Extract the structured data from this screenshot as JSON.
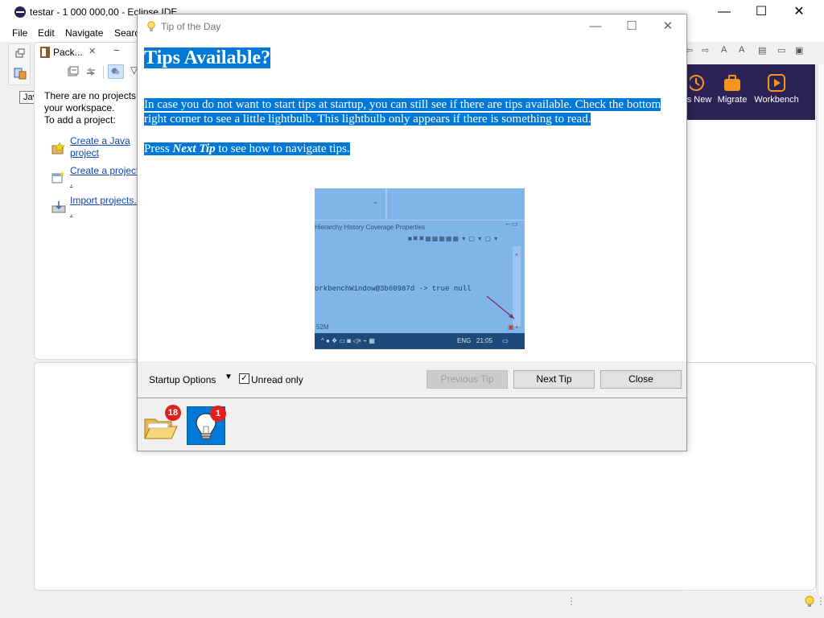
{
  "window": {
    "title": "testar - 1 000 000,00 - Eclipse IDE",
    "minimize_glyph": "—",
    "maximize_glyph": "☐",
    "close_glyph": "✕"
  },
  "menu": {
    "items": [
      "File",
      "Edit",
      "Navigate",
      "Searc"
    ]
  },
  "perspective": {
    "tooltip": "Java"
  },
  "package_explorer": {
    "tab_label": "Pack...",
    "tab_close": "✕",
    "message_line1": "There are no projects i",
    "message_line2": "your workspace.",
    "message_line3": "To add a project:",
    "links": [
      {
        "line1": "Create a Java",
        "line2": "project"
      },
      {
        "line1": "Create a project",
        "line2": "."
      },
      {
        "line1": "Import projects.",
        "line2": "."
      }
    ]
  },
  "welcome": {
    "items": [
      {
        "label": "s New",
        "icon": "whats-new-icon"
      },
      {
        "label": "Migrate",
        "icon": "briefcase-icon"
      },
      {
        "label": "Workbench",
        "icon": "play-icon"
      }
    ]
  },
  "dialog": {
    "title": "Tip of the Day",
    "heading": "Tips Available?",
    "paragraph": "In case you do not want to start tips at startup, you can still see if there are tips available. Check the bottom right corner to see a little lightbulb. This lightbulb only appears if there is something to read.",
    "press_prefix": "Press ",
    "press_emphasis": "Next Tip",
    "press_suffix": " to see how to navigate tips.",
    "image_texts": {
      "tabs": "Hierarchy  History  Coverage  Properties",
      "console": "orkbenchWindow@3b60987d -> true null",
      "mem": "52M",
      "taskbar_lang": "ENG",
      "taskbar_time": "21:05"
    },
    "startup_options": "Startup Options",
    "unread_only": "Unread only",
    "unread_checked": true,
    "buttons": {
      "previous": "Previous Tip",
      "next": "Next Tip",
      "close": "Close"
    },
    "badges": {
      "folder_count": "18",
      "bulb_count": "1"
    }
  },
  "colors": {
    "selection": "#0078d7",
    "welcome_bg": "#2c2255",
    "welcome_accent": "#f7941d",
    "badge": "#e02020"
  }
}
